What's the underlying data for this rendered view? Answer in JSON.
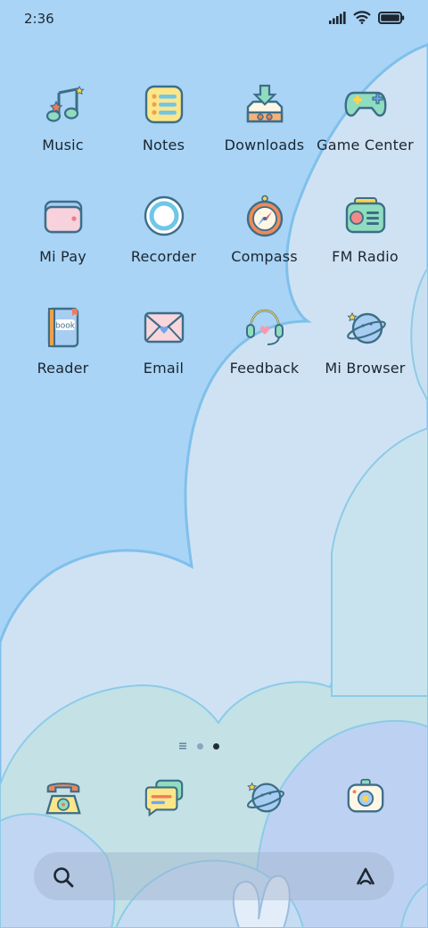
{
  "status_bar": {
    "time": "2:36",
    "icons": [
      "signal-icon",
      "wifi-icon",
      "battery-icon"
    ]
  },
  "apps": [
    {
      "label": "Music",
      "icon": "music-icon"
    },
    {
      "label": "Notes",
      "icon": "notes-icon"
    },
    {
      "label": "Downloads",
      "icon": "downloads-icon"
    },
    {
      "label": "Game Center",
      "icon": "gamepad-icon"
    },
    {
      "label": "Mi Pay",
      "icon": "wallet-icon"
    },
    {
      "label": "Recorder",
      "icon": "recorder-icon"
    },
    {
      "label": "Compass",
      "icon": "compass-icon"
    },
    {
      "label": "FM Radio",
      "icon": "radio-icon"
    },
    {
      "label": "Reader",
      "icon": "book-icon",
      "icon_text": "book"
    },
    {
      "label": "Email",
      "icon": "envelope-icon"
    },
    {
      "label": "Feedback",
      "icon": "headset-icon"
    },
    {
      "label": "Mi Browser",
      "icon": "planet-icon"
    }
  ],
  "page_indicator": {
    "pages": 3,
    "current": 3
  },
  "dock": [
    {
      "icon": "phone-icon"
    },
    {
      "icon": "messages-icon"
    },
    {
      "icon": "browser-icon"
    },
    {
      "icon": "camera-icon"
    }
  ],
  "search": {
    "left_icon": "search-icon",
    "right_icon": "assistant-icon"
  },
  "colors": {
    "sky": "#a9d4f5",
    "cloud": "#cfe2f3",
    "outline": "#7fc0ec",
    "text": "#1b2530"
  }
}
